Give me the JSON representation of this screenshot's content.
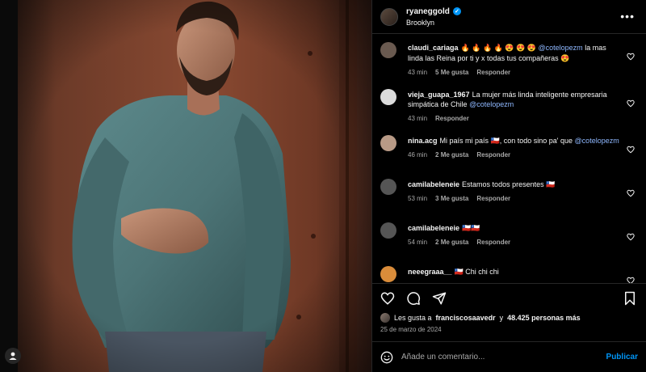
{
  "post": {
    "username": "ryaneggold",
    "location": "Brooklyn",
    "verified": true
  },
  "comments": [
    {
      "user": "claudi_cariaga",
      "text": "🔥 🔥 🔥 🔥 😍 😍 😍",
      "mention": "@cotelopezm",
      "text_after": " la mas linda las Reina por ti y x todas tus compañeras 😍",
      "time": "43 min",
      "likes": "5 Me gusta",
      "reply": "Responder",
      "avatar_color": "#6a5a50"
    },
    {
      "user": "vieja_guapa_1967",
      "text": "La mujer más linda inteligente empresaria simpática de Chile",
      "mention": "@cotelopezm",
      "text_after": "",
      "time": "43 min",
      "likes": "",
      "reply": "Responder",
      "avatar_color": "#dbdbdb"
    },
    {
      "user": "nina.acg",
      "text": "Mi país mi país 🇨🇱, con todo sino pa' que",
      "mention": "@cotelopezm",
      "text_after": "",
      "time": "46 min",
      "likes": "2 Me gusta",
      "reply": "Responder",
      "avatar_color": "#b89a86"
    },
    {
      "user": "camilabeleneie",
      "text": "Estamos todos presentes 🇨🇱",
      "mention": "",
      "text_after": "",
      "time": "53 min",
      "likes": "3 Me gusta",
      "reply": "Responder",
      "avatar_color": "#555555"
    },
    {
      "user": "camilabeleneie",
      "text": "🇨🇱🇨🇱",
      "mention": "",
      "text_after": "",
      "time": "54 min",
      "likes": "2 Me gusta",
      "reply": "Responder",
      "avatar_color": "#555555"
    },
    {
      "user": "neeegraaa__",
      "text": "🇨🇱 Chi chi chi",
      "mention": "",
      "text_after": "",
      "time": "1 h",
      "likes": "3 Me gusta",
      "reply": "Responder",
      "avatar_color": "#d98c3a"
    }
  ],
  "likes_summary": {
    "prefix": "Les gusta a",
    "user": "franciscosaavedr",
    "connector": "y",
    "count": "48.425 personas más"
  },
  "date": "25 de marzo de 2024",
  "add_comment": {
    "placeholder": "Añade un comentario...",
    "publish": "Publicar"
  },
  "icons": {
    "more": "more-icon",
    "like": "heart-icon",
    "comment": "comment-icon",
    "share": "share-icon",
    "save": "bookmark-icon",
    "emoji": "emoji-icon",
    "profile": "profile-icon"
  },
  "colors": {
    "background": "#000000",
    "accent": "#0095f6",
    "mention": "#8fb8ff",
    "secondary_text": "#a8a8a8"
  }
}
